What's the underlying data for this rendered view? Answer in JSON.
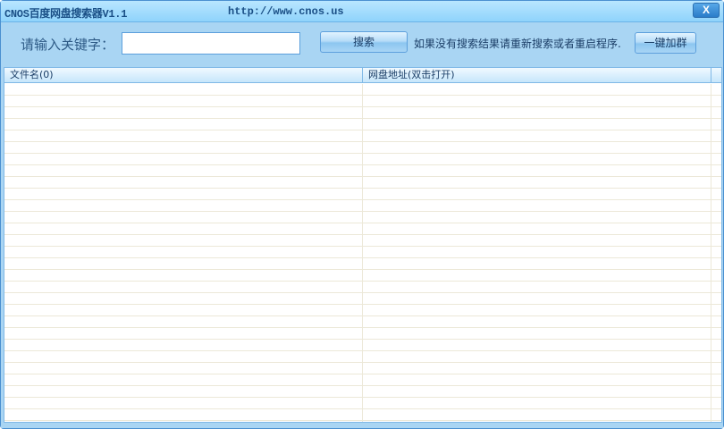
{
  "window": {
    "title": "CNOS百度网盘搜索器V1.1",
    "url": "http://www.cnos.us",
    "close_label": "X"
  },
  "search": {
    "label": "请输入关键字：",
    "value": "",
    "button": "搜索",
    "hint": "如果没有搜索结果请重新搜索或者重启程序.",
    "join_button": "一键加群"
  },
  "table": {
    "columns": [
      "文件名(0)",
      "网盘地址(双击打开)"
    ],
    "rows": []
  }
}
